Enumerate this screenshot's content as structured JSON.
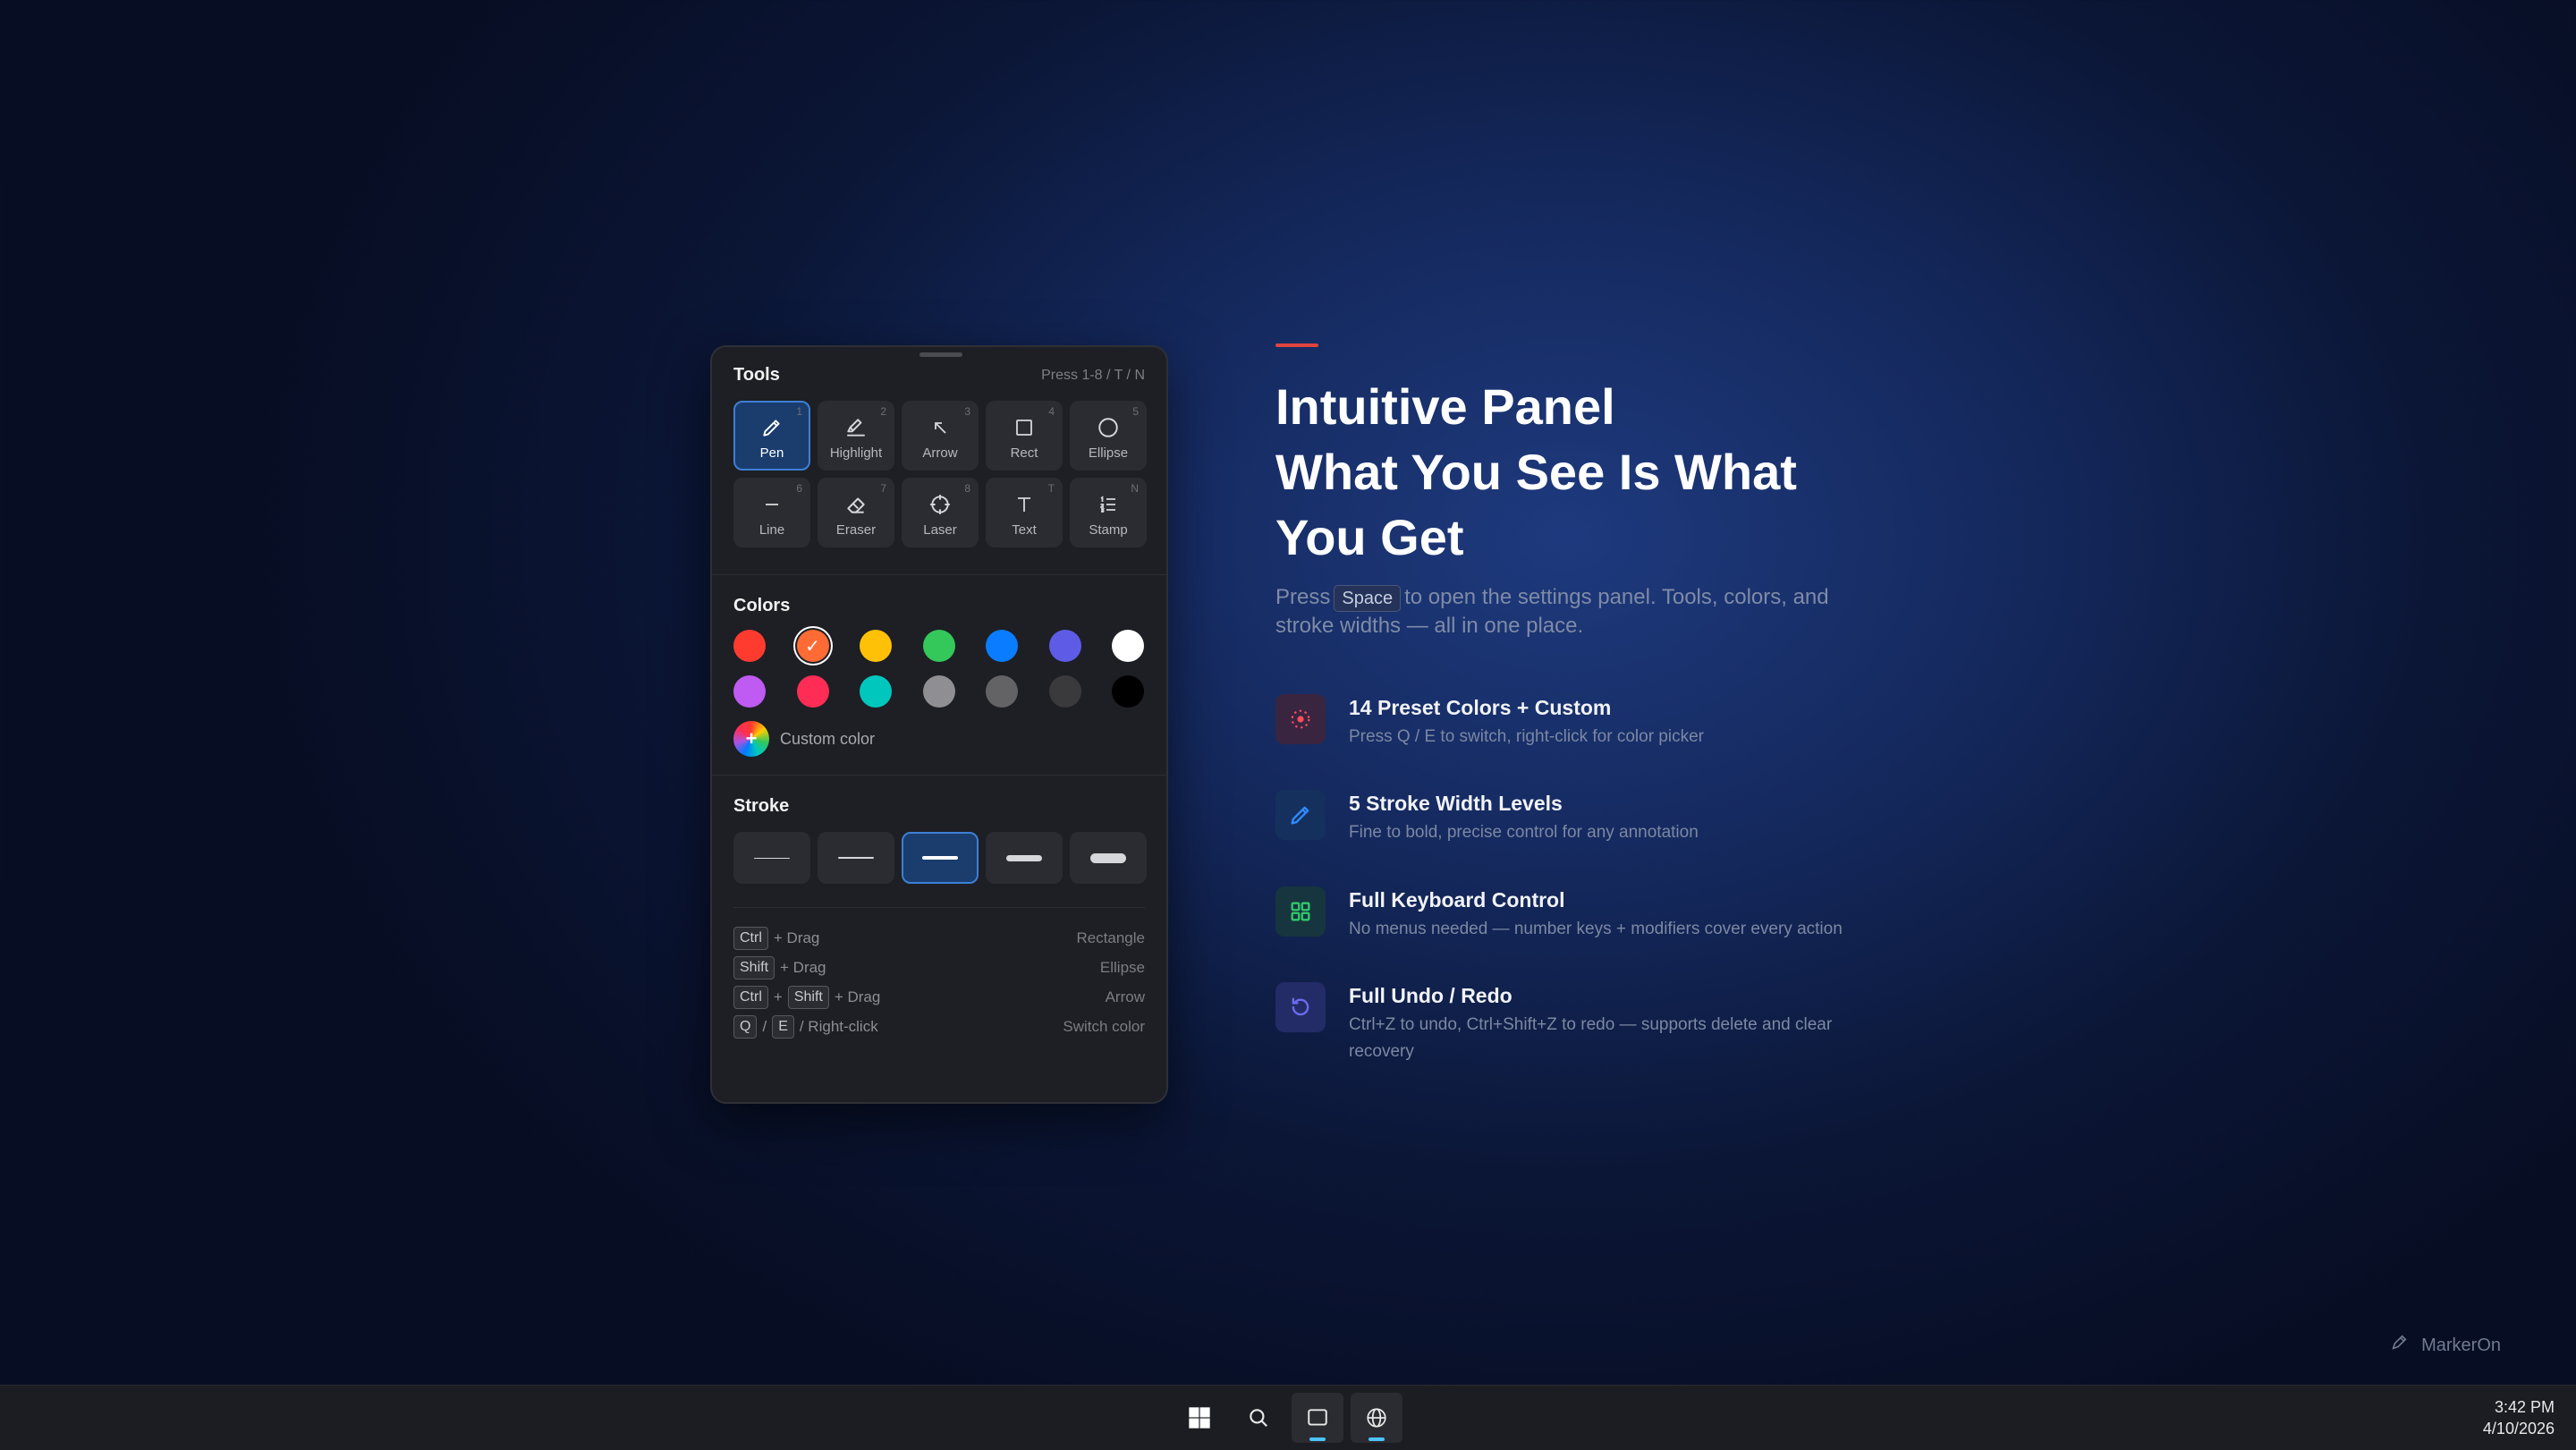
{
  "panel": {
    "tools_title": "Tools",
    "tools_hint": "Press 1-8 / T / N",
    "tools": [
      {
        "label": "Pen",
        "key": "1",
        "icon": "pen-icon",
        "active": true
      },
      {
        "label": "Highlight",
        "key": "2",
        "icon": "highlighter-icon"
      },
      {
        "label": "Arrow",
        "key": "3",
        "icon": "arrow-icon"
      },
      {
        "label": "Rect",
        "key": "4",
        "icon": "rectangle-icon"
      },
      {
        "label": "Ellipse",
        "key": "5",
        "icon": "ellipse-icon"
      },
      {
        "label": "Line",
        "key": "6",
        "icon": "line-icon"
      },
      {
        "label": "Eraser",
        "key": "7",
        "icon": "eraser-icon"
      },
      {
        "label": "Laser",
        "key": "8",
        "icon": "laser-icon"
      },
      {
        "label": "Text",
        "key": "T",
        "icon": "text-icon"
      },
      {
        "label": "Stamp",
        "key": "N",
        "icon": "stamp-icon"
      }
    ],
    "colors_title": "Colors",
    "colors": [
      "#ff3b30",
      "#ff6b35",
      "#ffc107",
      "#34c759",
      "#0a7cff",
      "#5e5ce6",
      "#ffffff",
      "#bf5af2",
      "#ff2d55",
      "#00c7be",
      "#8e8e93",
      "#636366",
      "#3a3a3c",
      "#000000"
    ],
    "selected_color_index": 1,
    "custom_color_label": "Custom color",
    "stroke_title": "Stroke",
    "stroke_levels": 5,
    "selected_stroke_index": 2,
    "shortcuts": [
      {
        "keys": [
          "Ctrl"
        ],
        "suffix": "+ Drag",
        "action": "Rectangle"
      },
      {
        "keys": [
          "Shift"
        ],
        "suffix": "+ Drag",
        "action": "Ellipse"
      },
      {
        "keys": [
          "Ctrl",
          "Shift"
        ],
        "suffix": "+ Drag",
        "action": "Arrow"
      },
      {
        "keys": [
          "Q",
          "E"
        ],
        "suffix": "/ Right-click",
        "action": "Switch color"
      }
    ]
  },
  "hero": {
    "headline_lines": [
      "Intuitive Panel",
      "What You See Is What",
      "You Get"
    ],
    "lead_before": "Press",
    "lead_key": "Space",
    "lead_after": "to open the settings panel. Tools, colors, and stroke widths — all in one place."
  },
  "features": [
    {
      "title": "14 Preset Colors + Custom",
      "desc": "Press Q / E to switch, right-click for color picker",
      "icon": "palette-icon",
      "color": "#ff4d5e",
      "bg": "#3a2540"
    },
    {
      "title": "5 Stroke Width Levels",
      "desc": "Fine to bold, precise control for any annotation",
      "icon": "pencil-icon",
      "color": "#2f8cff",
      "bg": "#16305e"
    },
    {
      "title": "Full Keyboard Control",
      "desc": "No menus needed — number keys + modifiers cover every action",
      "icon": "grid-icon",
      "color": "#30c96b",
      "bg": "#17353e"
    },
    {
      "title": "Full Undo / Redo",
      "desc": "Ctrl+Z to undo, Ctrl+Shift+Z to redo — supports delete and clear recovery",
      "icon": "undo-icon",
      "color": "#6b6cf0",
      "bg": "#232c66"
    }
  ],
  "brand": {
    "name": "MarkerOn",
    "icon": "marker-icon"
  },
  "taskbar": {
    "time": "3:42 PM",
    "date": "4/10/2026",
    "icons": [
      "windows-start-icon",
      "search-icon",
      "window-icon",
      "globe-icon"
    ]
  }
}
